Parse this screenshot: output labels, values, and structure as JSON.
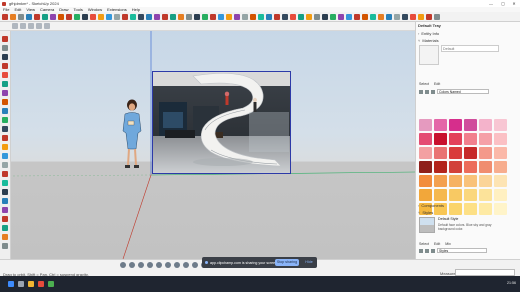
{
  "window": {
    "title": "gfhjdmkm* - SketchUp 2024",
    "controls": {
      "minimize": "—",
      "maximize": "▢",
      "close": "✕"
    }
  },
  "menu": [
    "File",
    "Edit",
    "View",
    "Camera",
    "Draw",
    "Tools",
    "Window",
    "Extensions",
    "Help"
  ],
  "tray": {
    "title": "Default Tray",
    "sections": {
      "entity_info": "Entity Info",
      "materials": "Materials",
      "material_name": "Default",
      "tabs": [
        "Select",
        "Edit"
      ],
      "library": "Colors Named",
      "components": "Components",
      "styles": "Styles",
      "style_name": "Default Style",
      "style_description": "Default face colors. Blue sky and gray background color.",
      "style_tabs": [
        "Select",
        "Edit",
        "Mix"
      ],
      "style_library": "Styles"
    },
    "swatches": [
      "#e59abf",
      "#e466a8",
      "#d62e8c",
      "#d04d9c",
      "#f4b3cb",
      "#f8c6d3",
      "#e44c73",
      "#c8102e",
      "#e3405a",
      "#f17f8d",
      "#f5a0a7",
      "#fbc0c4",
      "#f3a0a2",
      "#e97373",
      "#d93b3b",
      "#c62828",
      "#f4998a",
      "#fbb8a8",
      "#8e1f1a",
      "#b3241c",
      "#d2413a",
      "#ec6c5b",
      "#f08d6f",
      "#f7ad8e",
      "#f28d3e",
      "#f3a04f",
      "#f6b262",
      "#f9c27a",
      "#fbd497",
      "#fde4b3",
      "#f2a73a",
      "#f5b84e",
      "#f8c963",
      "#fad77d",
      "#fce39a",
      "#fff0c1",
      "#f4b73f",
      "#f8c654",
      "#fad46b",
      "#fde086",
      "#feeaa4",
      "#fff4c9"
    ]
  },
  "status": {
    "text": "Drag to orbit. Shift = Pan, Ctrl = suspend gravity.",
    "measurements_label": "Measurements"
  },
  "share": {
    "message": "app.clipchamp.com is sharing your screen.",
    "stop_label": "Stop sharing",
    "hide_label": "Hide"
  },
  "taskbar": {
    "time": "21:56"
  },
  "colors": {
    "accent": "#2d3aa8",
    "share_button": "#8ab4f8",
    "axis_red": "#c0392b",
    "axis_green": "#27ae60",
    "axis_blue": "#2e5fd1"
  }
}
